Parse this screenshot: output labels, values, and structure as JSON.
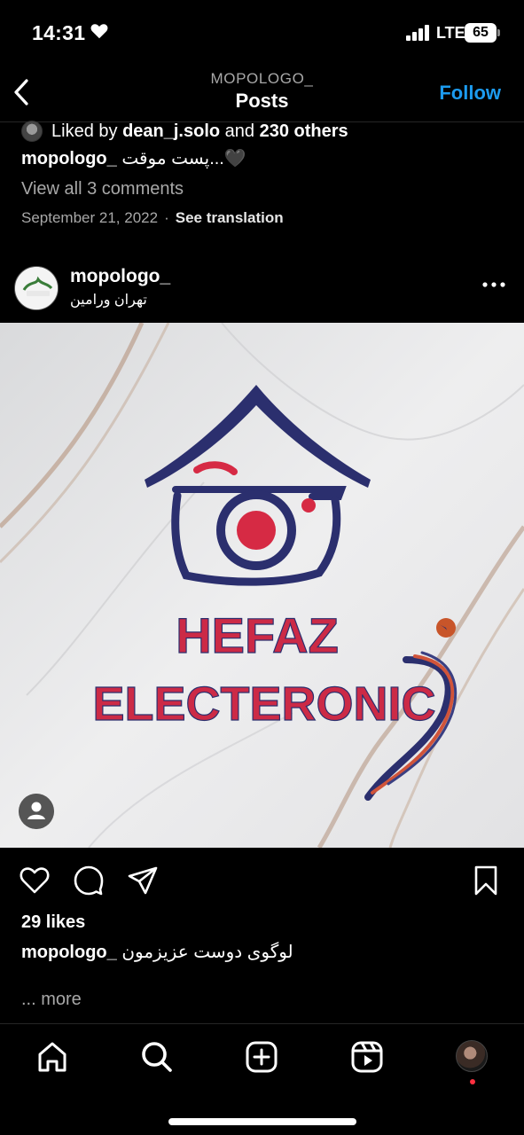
{
  "status_bar": {
    "time": "14:31",
    "network": "LTE",
    "battery": "65"
  },
  "header": {
    "subtitle": "MOPOLOGO_",
    "title": "Posts",
    "follow_label": "Follow"
  },
  "previous_post": {
    "liked_prefix": "Liked by",
    "liked_user": "dean_j.solo",
    "liked_and": "and",
    "liked_others": "230 others",
    "caption_user": "mopologo_",
    "caption_text": "پست موقت...🖤",
    "view_comments": "View all 3 comments",
    "date": "September 21, 2022",
    "date_separator": "·",
    "see_translation": "See translation"
  },
  "post": {
    "username": "mopologo_",
    "location": "تهران ورامین",
    "image_text": {
      "line1": "HEFAZ",
      "line2": "ELECTERONIC"
    },
    "likes": "29 likes",
    "caption_user": "mopologo_",
    "caption_text": "لوگوی دوست عزیزمون",
    "more": "... more"
  },
  "colors": {
    "accent_blue": "#1c9bef",
    "logo_navy": "#2b2f6e",
    "logo_red": "#d62a44",
    "notification_red": "#ff3040"
  },
  "icons": {
    "status": [
      "heart-icon",
      "signal-icon",
      "battery-icon"
    ],
    "header": [
      "back-chevron-icon"
    ],
    "post": [
      "more-options-icon",
      "user-tag-icon"
    ],
    "actions": [
      "like-heart-icon",
      "comment-icon",
      "share-icon",
      "save-bookmark-icon"
    ],
    "tabs": [
      "home-icon",
      "search-icon",
      "create-post-icon",
      "reels-icon",
      "profile-avatar"
    ]
  }
}
